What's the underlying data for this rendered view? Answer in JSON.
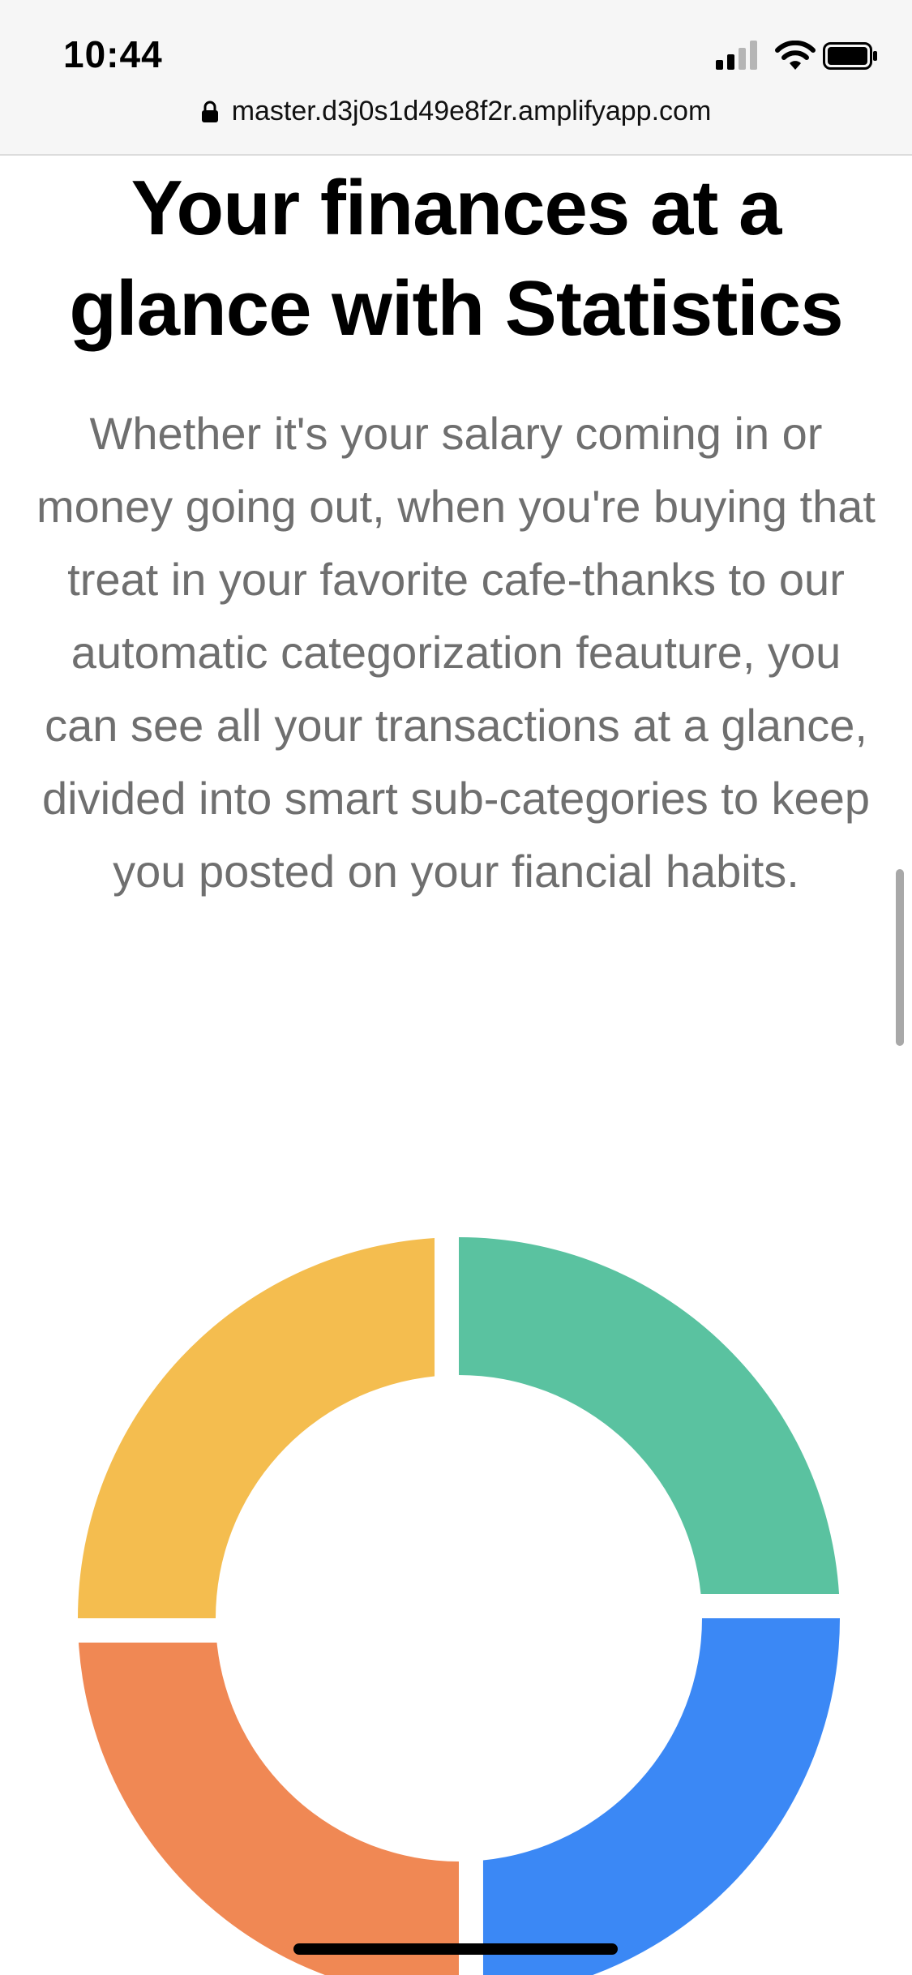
{
  "status_bar": {
    "time": "10:44",
    "icons": [
      "signal-icon",
      "wifi-icon",
      "battery-icon"
    ]
  },
  "url_bar": {
    "url": "master.d3j0s1d49e8f2r.amplifyapp.com",
    "icon": "lock-icon"
  },
  "content": {
    "headline": "Your finances at a glance with Statistics",
    "description": "Whether it's your salary coming in or money going out, when you're buying that treat in your favorite cafe-thanks to our automatic categorization feauture, you can see all your transactions at a glance, divided into smart sub-categories to keep you posted on your fiancial habits."
  },
  "colors": {
    "text_primary": "#000000",
    "text_secondary": "#6f6f6f",
    "slice_blue": "#3b88f5",
    "slice_orange": "#f08854",
    "slice_yellow": "#f4bd4f",
    "slice_green": "#5ac2a0"
  },
  "chart_data": {
    "type": "pie",
    "style": "donut",
    "legend": "none",
    "slices": [
      {
        "value": 25,
        "color": "#3b88f5"
      },
      {
        "value": 25,
        "color": "#f08854"
      },
      {
        "value": 25,
        "color": "#f4bd4f"
      },
      {
        "value": 25,
        "color": "#5ac2a0"
      }
    ]
  }
}
